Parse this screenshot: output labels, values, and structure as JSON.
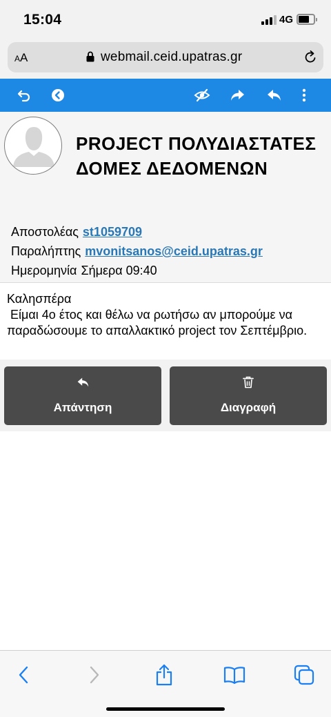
{
  "status_bar": {
    "time": "15:04",
    "network": "4G",
    "signal_bars_active": 3,
    "signal_bars_total": 4,
    "battery_level": 0.7
  },
  "browser": {
    "text_size_small": "A",
    "text_size_large": "A",
    "url": "webmail.ceid.upatras.gr"
  },
  "toolbar": {
    "color": "#1e88e5",
    "icons": [
      "undo-icon",
      "back-circle-icon",
      "mark-unread-icon",
      "forward-icon",
      "reply-icon",
      "more-vertical-icon"
    ]
  },
  "message": {
    "subject": "PROJECT ΠΟΛΥΔΙΑΣΤΑΤΕΣ ΔΟΜΕΣ ΔΕΔΟΜΕΝΩΝ",
    "from_label": "Αποστολέας",
    "from_value": "st1059709",
    "to_label": "Παραλήπτης",
    "to_value": "mvonitsanos@ceid.upatras.gr",
    "date_label": "Ημερομηνία",
    "date_value": "Σήμερα 09:40",
    "link_color": "#2a77b5",
    "body_greeting": "Καλησπέρα",
    "body_text": " Είμαι 4ο έτος και θέλω να ρωτήσω αν μπορούμε να παραδώσουμε το απαλλακτικό project τον Σεπτέμβριο."
  },
  "actions": {
    "reply_label": "Απάντηση",
    "delete_label": "Διαγραφή",
    "button_color": "#4a4a4a"
  },
  "safari_bar": {
    "icons": [
      "back-icon",
      "forward-disabled-icon",
      "share-icon",
      "bookmarks-icon",
      "tabs-icon"
    ],
    "accent": "#1a7ff5"
  }
}
